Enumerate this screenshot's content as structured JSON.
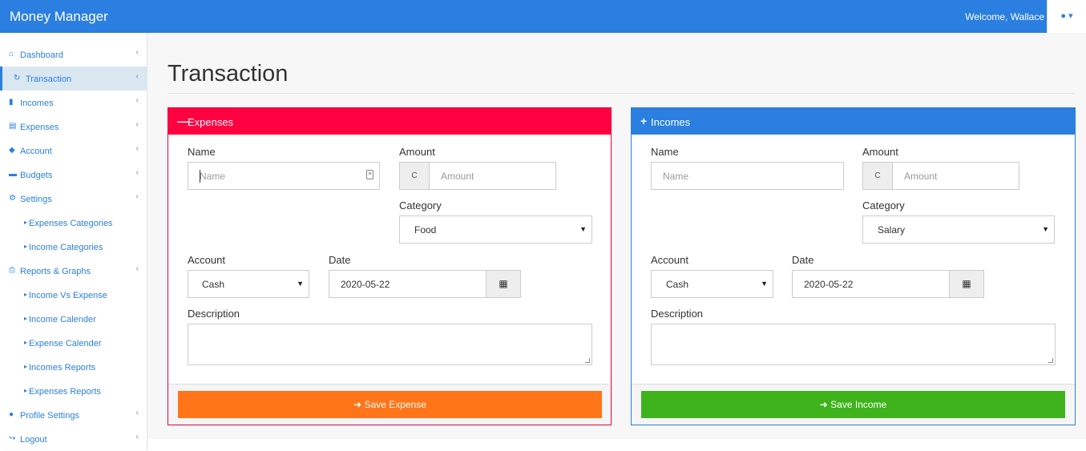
{
  "app": {
    "title": "Money Manager",
    "welcome": "Welcome, Wallace",
    "user_icon": "user-icon"
  },
  "sidebar": {
    "items": [
      {
        "label": "Dashboard",
        "icon": "home-icon"
      },
      {
        "label": "Transaction",
        "icon": "refresh-icon",
        "active": true
      },
      {
        "label": "Incomes",
        "icon": "bar-chart-icon"
      },
      {
        "label": "Expenses",
        "icon": "list-icon"
      },
      {
        "label": "Account",
        "icon": "tag-icon"
      },
      {
        "label": "Budgets",
        "icon": "archive-icon"
      },
      {
        "label": "Settings",
        "icon": "cogs-icon"
      },
      {
        "label": "Expenses Categories",
        "icon": "caret-right-icon",
        "sub": true
      },
      {
        "label": "Income Categories",
        "icon": "caret-right-icon",
        "sub": true
      },
      {
        "label": "Reports & Graphs",
        "icon": "print-icon"
      },
      {
        "label": "Income Vs Expense",
        "icon": "caret-right-icon",
        "sub": true
      },
      {
        "label": "Income Calender",
        "icon": "caret-right-icon",
        "sub": true
      },
      {
        "label": "Expense Calender",
        "icon": "caret-right-icon",
        "sub": true
      },
      {
        "label": "Incomes Reports",
        "icon": "caret-right-icon",
        "sub": true
      },
      {
        "label": "Expenses Reports",
        "icon": "caret-right-icon",
        "sub": true
      },
      {
        "label": "Profile Settings",
        "icon": "user-icon"
      },
      {
        "label": "Logout",
        "icon": "sign-out-icon"
      }
    ]
  },
  "page": {
    "title": "Transaction"
  },
  "expenses": {
    "header": "Expenses",
    "name_label": "Name",
    "name_placeholder": "Name",
    "amount_label": "Amount",
    "amount_addon": "C",
    "amount_placeholder": "Amount",
    "category_label": "Category",
    "category_value": "Food",
    "account_label": "Account",
    "account_value": "Cash",
    "date_label": "Date",
    "date_value": "2020-05-22",
    "description_label": "Description",
    "save_label": "Save Expense",
    "color": "#ff0040",
    "button_color": "#ff7518"
  },
  "incomes": {
    "header": "Incomes",
    "name_label": "Name",
    "name_placeholder": "Name",
    "amount_label": "Amount",
    "amount_addon": "C",
    "amount_placeholder": "Amount",
    "category_label": "Category",
    "category_value": "Salary",
    "account_label": "Account",
    "account_value": "Cash",
    "date_label": "Date",
    "date_value": "2020-05-22",
    "description_label": "Description",
    "save_label": "Save Income",
    "color": "#2a7fe0",
    "button_color": "#3fb31c"
  }
}
